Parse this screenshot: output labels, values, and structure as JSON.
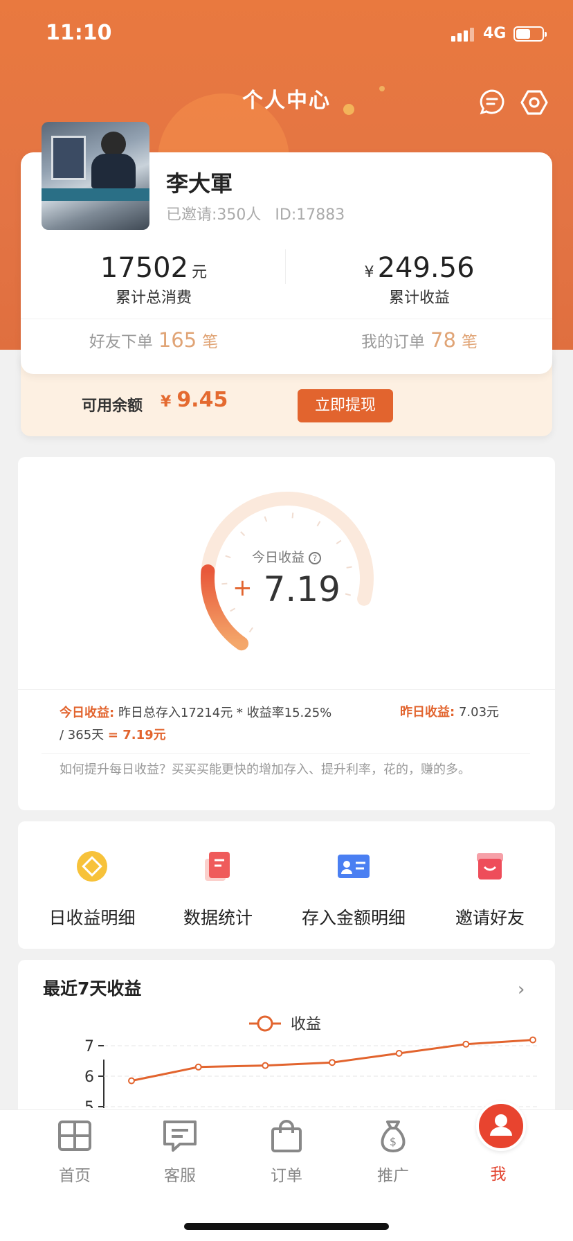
{
  "status_bar": {
    "time": "11:10",
    "network": "4G"
  },
  "header": {
    "title": "个人中心"
  },
  "profile": {
    "name": "李大軍",
    "invited": "已邀请:350人",
    "id": "ID:17883",
    "total_spend": {
      "value": "17502",
      "unit": "元",
      "label": "累计总消费"
    },
    "total_income": {
      "currency": "¥",
      "value": "249.56",
      "label": "累计收益"
    },
    "friend_orders": {
      "label": "好友下单",
      "count": "165",
      "unit": "笔"
    },
    "my_orders": {
      "label": "我的订单",
      "count": "78",
      "unit": "笔"
    }
  },
  "balance": {
    "label": "可用余额",
    "currency": "¥",
    "value": "9.45",
    "withdraw_label": "立即提现"
  },
  "today_income": {
    "label": "今日收益",
    "sign": "+",
    "value": "7.19",
    "gauge_fraction": 0.24,
    "formula_label": "今日收益:",
    "formula_text": "昨日总存入17214元 * 收益率15.25% / 365天",
    "formula_result": "= 7.19元",
    "yesterday_label": "昨日收益:",
    "yesterday_value": "7.03元",
    "tip": "如何提升每日收益？买买买能更快的增加存入、提升利率，花的，赚的多。"
  },
  "menu": [
    {
      "label": "日收益明细",
      "icon": "coin-icon"
    },
    {
      "label": "数据统计",
      "icon": "report-icon"
    },
    {
      "label": "存入金额明细",
      "icon": "id-card-icon"
    },
    {
      "label": "邀请好友",
      "icon": "gift-icon"
    }
  ],
  "chart_section": {
    "title": "最近7天收益",
    "legend": "收益"
  },
  "chart_data": {
    "type": "line",
    "series": [
      {
        "name": "收益",
        "values": [
          5.85,
          6.3,
          6.35,
          6.45,
          6.75,
          7.05,
          7.19
        ]
      }
    ],
    "y_ticks": [
      "7",
      "6",
      "5"
    ],
    "ylim": [
      5,
      7.5
    ],
    "color": "#e2642e"
  },
  "tabbar": [
    {
      "label": "首页",
      "icon": "home-grid-icon"
    },
    {
      "label": "客服",
      "icon": "chat-icon"
    },
    {
      "label": "订单",
      "icon": "bag-icon"
    },
    {
      "label": "推广",
      "icon": "money-bag-icon"
    },
    {
      "label": "我",
      "icon": "user-icon"
    }
  ]
}
